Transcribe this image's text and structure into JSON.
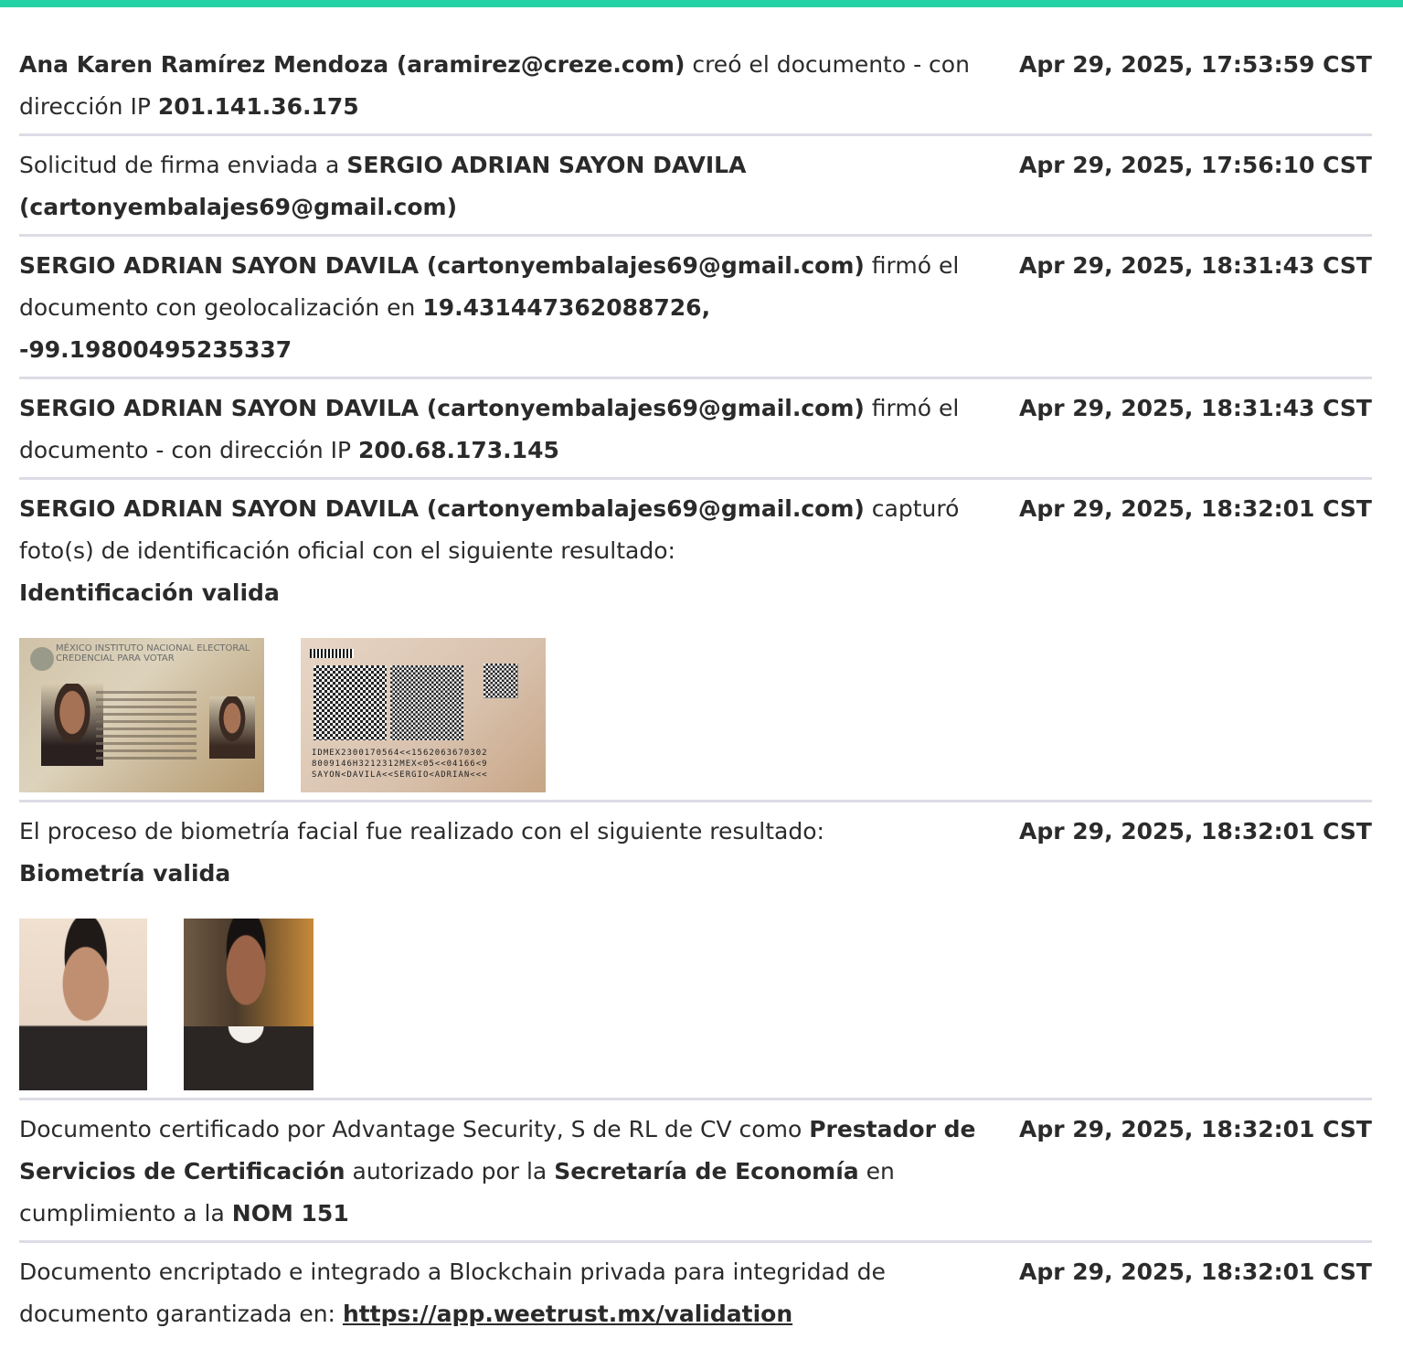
{
  "entries": [
    {
      "bold": "Ana Karen Ramírez Mendoza (aramirez@creze.com)",
      "text": " creó el documento - con dirección IP ",
      "ip": "201.141.36.175",
      "time": "Apr 29, 2025, 17:53:59 CST"
    },
    {
      "text": "Solicitud de firma enviada a ",
      "bold": "SERGIO ADRIAN SAYON DAVILA (cartonyembalajes69@gmail.com)",
      "time": "Apr 29, 2025, 17:56:10 CST"
    },
    {
      "bold": "SERGIO ADRIAN SAYON DAVILA (cartonyembalajes69@gmail.com)",
      "text": " firmó el documento con geolocalización en ",
      "geo": "19.431447362088726, -99.19800495235337",
      "time": "Apr 29, 2025, 18:31:43 CST"
    },
    {
      "bold": "SERGIO ADRIAN SAYON DAVILA (cartonyembalajes69@gmail.com)",
      "text": " firmó el documento - con dirección IP ",
      "ip": "200.68.173.145",
      "time": "Apr 29, 2025, 18:31:43 CST"
    },
    {
      "bold": "SERGIO ADRIAN SAYON DAVILA (cartonyembalajes69@gmail.com)",
      "text": " capturó foto(s) de identificación oficial con el siguiente resultado:",
      "result": "Identificación valida",
      "time": "Apr 29, 2025, 18:32:01 CST",
      "id_front": {
        "line1": "INSTITUTO NACIONAL ELECTORAL",
        "line2": "CREDENCIAL PARA VOTAR",
        "country": "MÉXICO"
      },
      "id_back": {
        "mrz1": "IDMEX2300170564<<1562063670302",
        "mrz2": "8009146H3212312MEX<05<<04166<9",
        "mrz3": "SAYON<DAVILA<<SERGIO<ADRIAN<<<"
      }
    },
    {
      "text": "El proceso de biometría facial fue realizado con el siguiente resultado:",
      "result": "Biometría valida",
      "time": "Apr 29, 2025, 18:32:01 CST"
    },
    {
      "text1": "Documento certificado por Advantage Security, S de RL de CV como ",
      "bold1": "Prestador de Servicios de Certificación",
      "text2": " autorizado por la ",
      "bold2": "Secretaría de Economía",
      "text3": " en cumplimiento a la ",
      "bold3": "NOM 151",
      "time": "Apr 29, 2025, 18:32:01 CST"
    },
    {
      "text": "Documento encriptado e integrado a Blockchain privada para integridad de documento garantizada en: ",
      "link": "https://app.weetrust.mx/validation",
      "time": "Apr 29, 2025, 18:32:01 CST"
    }
  ]
}
